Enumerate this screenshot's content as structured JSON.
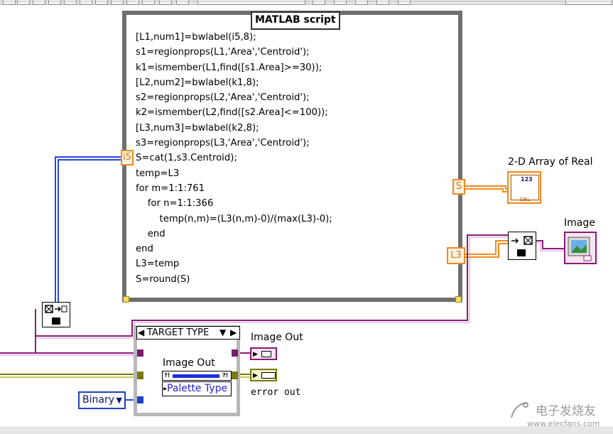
{
  "script_node": {
    "title": "MATLAB script",
    "lines": [
      "[L1,num1]=bwlabel(i5,8);",
      "s1=regionprops(L1,'Area','Centroid');",
      "k1=ismember(L1,find([s1.Area]>=30));",
      "[L2,num2]=bwlabel(k1,8);",
      "s2=regionprops(L2,'Area','Centroid');",
      "k2=ismember(L2,find([s2.Area]<=100));",
      "[L3,num3]=bwlabel(k2,8);",
      "s3=regionprops(L3,'Area','Centroid');",
      "S=cat(1,s3.Centroid);",
      "temp=L3",
      "for m=1:1:761",
      "    for n=1:1:366",
      "        temp(n,m)=(L3(n,m)-0)/(max(L3)-0);",
      "    end",
      "end",
      "L3=temp",
      "S=round(S)"
    ],
    "input_terminal": "i5",
    "output_terminals": [
      "S",
      "L3"
    ]
  },
  "indicators": {
    "array_label": "2-D Array of Real",
    "array_icon_text": "123",
    "array_icon_sub": "DBL",
    "image_label": "Image"
  },
  "case_structure": {
    "selector": "TARGET TYPE",
    "inner_label": "Image Out",
    "palette": "Palette Type"
  },
  "outputs": {
    "image_out": "Image Out",
    "error_out": "error out"
  },
  "binary_constant": "Binary",
  "watermark": {
    "brand": "电子发烧友",
    "url": "www.elecfans.com"
  },
  "colors": {
    "wire_blue": "#2848d8",
    "wire_orange": "#f08a1e",
    "wire_purple": "#8a1a78",
    "wire_olive": "#7a7a10",
    "frame_grey": "#6f6f6f"
  }
}
